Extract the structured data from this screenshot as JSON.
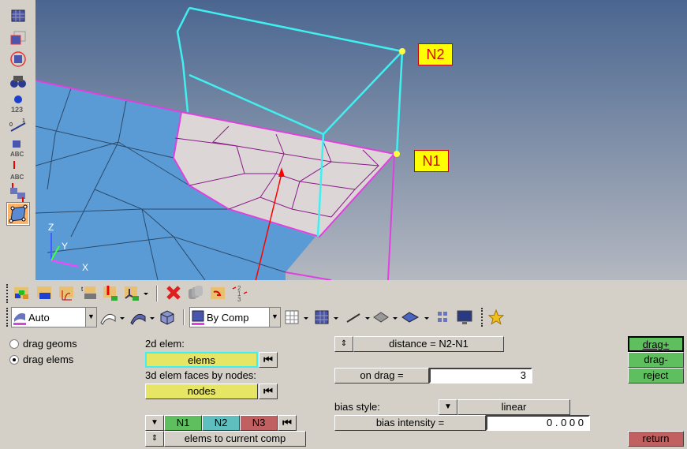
{
  "viewport": {
    "labels": {
      "n1": "N1",
      "n2": "N2"
    },
    "axes": {
      "x": "X",
      "y": "Y",
      "z": "Z"
    },
    "colors": {
      "shell": "#5b9bd5",
      "patch": "#dcd6d6",
      "edge": "#e040e0",
      "box": "#40f0f0",
      "arrow": "#ff0000"
    }
  },
  "left_toolbar": [
    "mask-elements-icon",
    "mask-box-icon",
    "mask-circle-icon",
    "find-binoculars-icon",
    "info-123-icon",
    "scale-icon",
    "abc-label-icon",
    "abc-arrow-icon",
    "reorient-icon",
    "drag-shape-icon"
  ],
  "toolbar1": [
    "collectors-icon",
    "component-icon",
    "material-icon",
    "property-icon",
    "load-collector-icon",
    "system-icon",
    "delete-icon",
    "organize-icon",
    "move-folder-icon",
    "renumber-icon"
  ],
  "toolbar2": {
    "geom_color_mode": "Auto",
    "elem_color_mode": "By Comp"
  },
  "panel": {
    "radio": [
      {
        "label": "drag geoms",
        "checked": false
      },
      {
        "label": "drag elems",
        "checked": true
      }
    ],
    "elem2d_label": "2d elem:",
    "elems_button": "elems",
    "faces_label": "3d elem faces by nodes:",
    "nodes_button": "nodes",
    "n1": "N1",
    "n2": "N2",
    "n3": "N3",
    "comp_option": "elems to current comp",
    "distance": "distance = N2-N1",
    "on_drag_label": "on drag =",
    "on_drag_value": "3",
    "bias_style_label": "bias style:",
    "bias_style": "linear",
    "bias_intensity_label": "bias intensity =",
    "bias_intensity_value": "0 . 0 0 0",
    "drag_plus": "drag+",
    "drag_minus": "drag-",
    "reject": "reject",
    "return": "return"
  }
}
